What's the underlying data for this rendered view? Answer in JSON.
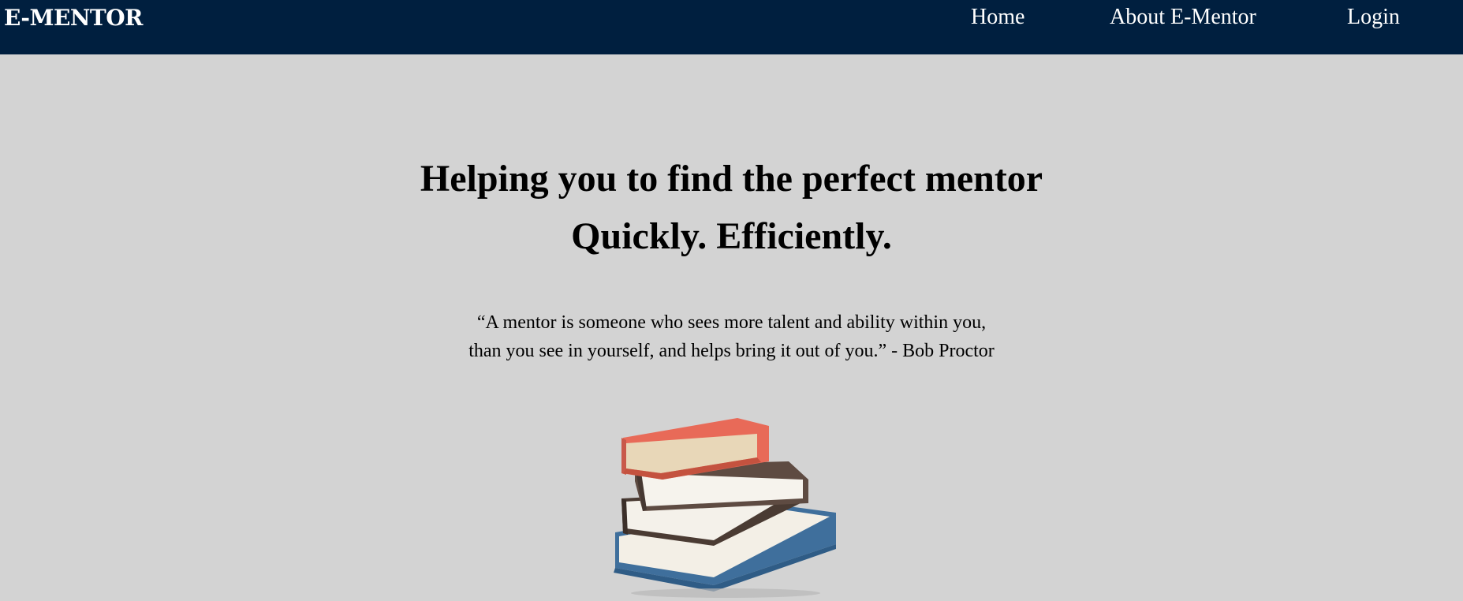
{
  "navbar": {
    "logo": "E-MENTOR",
    "links": [
      {
        "label": "Home"
      },
      {
        "label": "About E-Mentor"
      },
      {
        "label": "Login"
      }
    ],
    "background": "#001f3f"
  },
  "hero": {
    "headline_line1": "Helping you to find the perfect mentor",
    "headline_line2": "Quickly. Efficiently.",
    "quote_line1": "“A mentor is someone who sees more talent and ability within you,",
    "quote_line2": "than you see in yourself, and helps bring it out of you.” - Bob Proctor",
    "image_icon": "stack-of-books-icon"
  },
  "colors": {
    "page_background": "#d3d3d3",
    "nav_text": "#ffffff"
  }
}
